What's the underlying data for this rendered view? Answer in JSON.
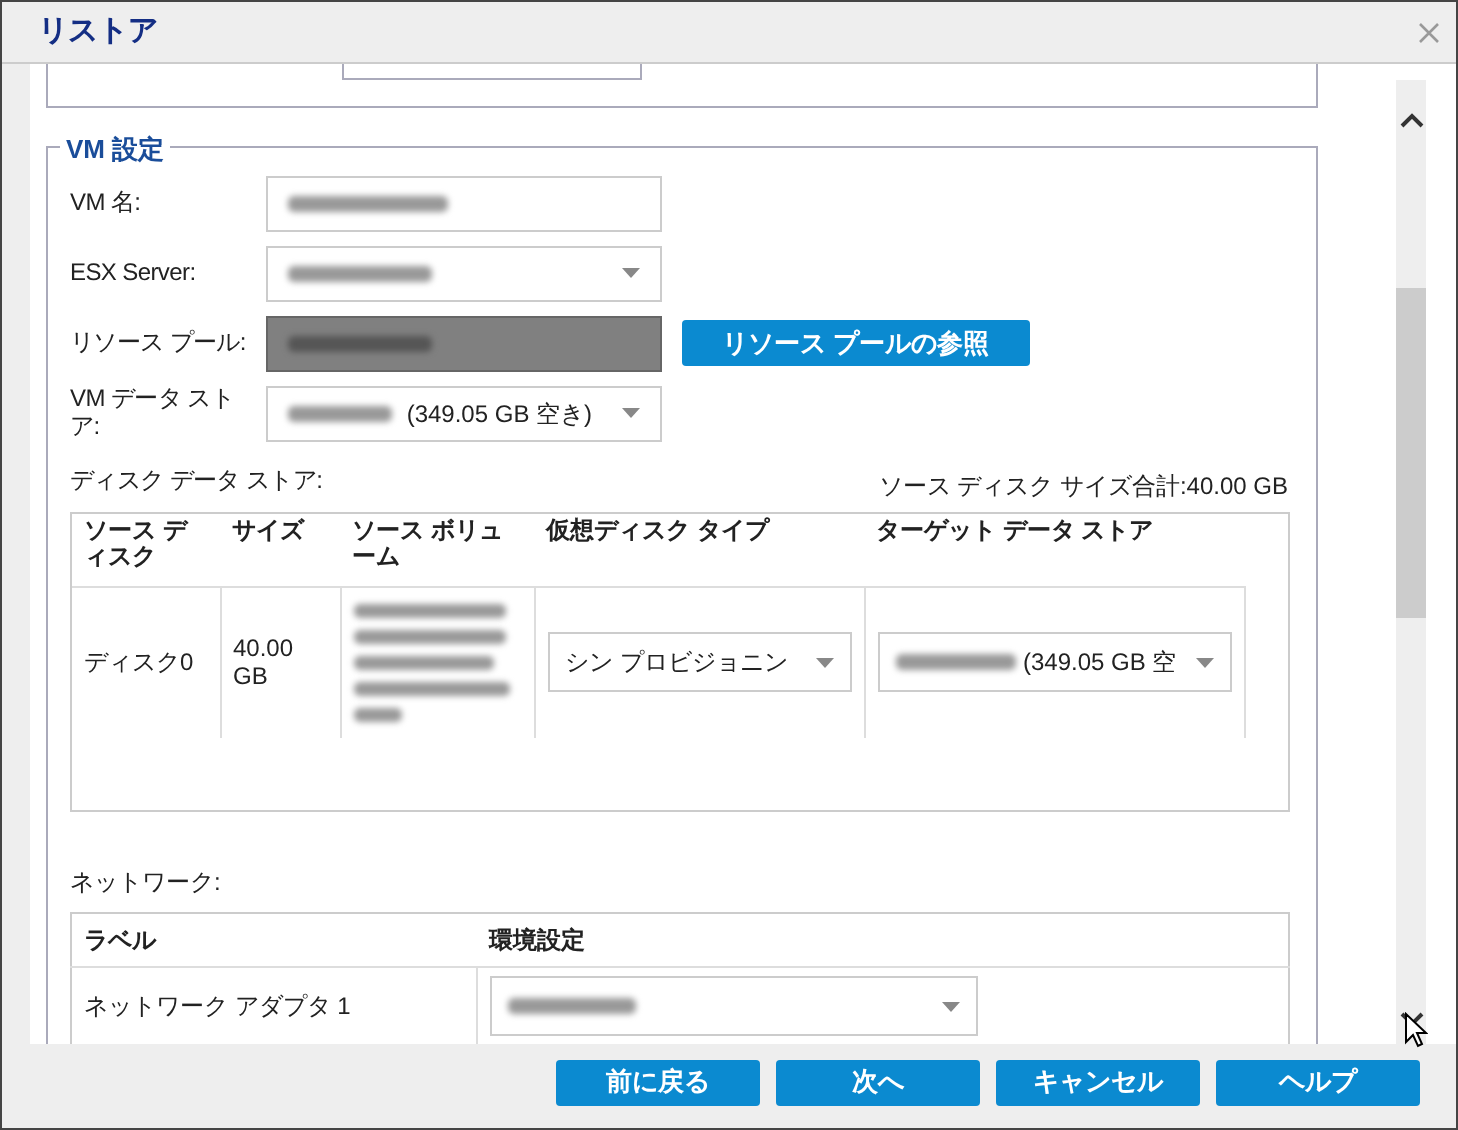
{
  "window": {
    "title": "リストア"
  },
  "vm_settings": {
    "legend": "VM 設定",
    "fields": [
      {
        "label": "VM 名:",
        "kind": "text"
      },
      {
        "label": "ESX Server:",
        "kind": "select"
      },
      {
        "label": "リソース プール:",
        "kind": "readonly",
        "button": "リソース プールの参照"
      },
      {
        "label": "VM データ ストア:",
        "kind": "select",
        "value_suffix": "(349.05 GB 空き)"
      }
    ],
    "disk_datastore_label": "ディスク データ ストア:",
    "total_size": "ソース ディスク サイズ合計:40.00 GB",
    "disks": {
      "columns": [
        "ソース ディスク",
        "サイズ",
        "ソース ボリューム",
        "仮想ディスク タイプ",
        "ターゲット データ ストア"
      ],
      "rows": [
        {
          "disk": "ディスク0",
          "size": "40.00 GB",
          "disk_type": "シン プロビジョニン",
          "target_suffix": "(349.05 GB 空"
        }
      ]
    }
  },
  "network": {
    "label": "ネットワーク:",
    "columns": [
      "ラベル",
      "環境設定"
    ],
    "rows": [
      {
        "label": "ネットワーク アダプタ 1"
      }
    ]
  },
  "buttons": [
    "前に戻る",
    "次へ",
    "キャンセル",
    "ヘルプ"
  ]
}
